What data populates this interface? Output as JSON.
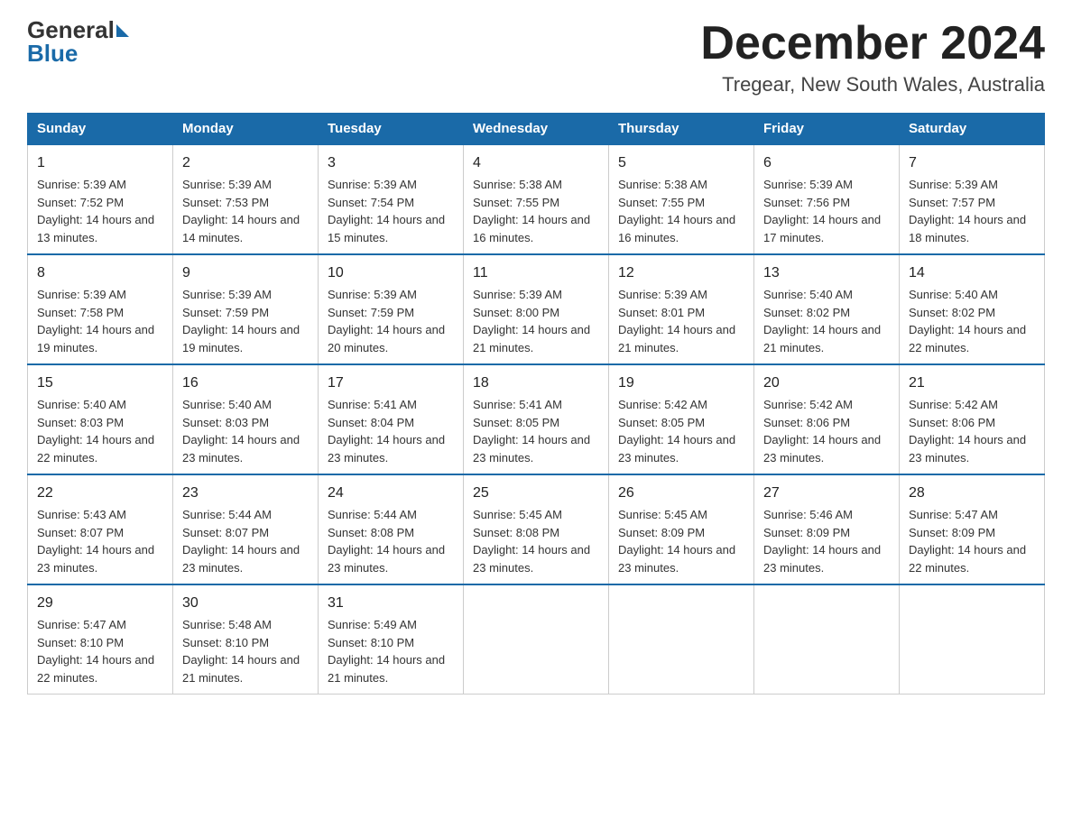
{
  "header": {
    "logo_general": "General",
    "logo_blue": "Blue",
    "month_title": "December 2024",
    "location": "Tregear, New South Wales, Australia"
  },
  "weekdays": [
    "Sunday",
    "Monday",
    "Tuesday",
    "Wednesday",
    "Thursday",
    "Friday",
    "Saturday"
  ],
  "weeks": [
    [
      {
        "day": "1",
        "sunrise": "5:39 AM",
        "sunset": "7:52 PM",
        "daylight": "14 hours and 13 minutes."
      },
      {
        "day": "2",
        "sunrise": "5:39 AM",
        "sunset": "7:53 PM",
        "daylight": "14 hours and 14 minutes."
      },
      {
        "day": "3",
        "sunrise": "5:39 AM",
        "sunset": "7:54 PM",
        "daylight": "14 hours and 15 minutes."
      },
      {
        "day": "4",
        "sunrise": "5:38 AM",
        "sunset": "7:55 PM",
        "daylight": "14 hours and 16 minutes."
      },
      {
        "day": "5",
        "sunrise": "5:38 AM",
        "sunset": "7:55 PM",
        "daylight": "14 hours and 16 minutes."
      },
      {
        "day": "6",
        "sunrise": "5:39 AM",
        "sunset": "7:56 PM",
        "daylight": "14 hours and 17 minutes."
      },
      {
        "day": "7",
        "sunrise": "5:39 AM",
        "sunset": "7:57 PM",
        "daylight": "14 hours and 18 minutes."
      }
    ],
    [
      {
        "day": "8",
        "sunrise": "5:39 AM",
        "sunset": "7:58 PM",
        "daylight": "14 hours and 19 minutes."
      },
      {
        "day": "9",
        "sunrise": "5:39 AM",
        "sunset": "7:59 PM",
        "daylight": "14 hours and 19 minutes."
      },
      {
        "day": "10",
        "sunrise": "5:39 AM",
        "sunset": "7:59 PM",
        "daylight": "14 hours and 20 minutes."
      },
      {
        "day": "11",
        "sunrise": "5:39 AM",
        "sunset": "8:00 PM",
        "daylight": "14 hours and 21 minutes."
      },
      {
        "day": "12",
        "sunrise": "5:39 AM",
        "sunset": "8:01 PM",
        "daylight": "14 hours and 21 minutes."
      },
      {
        "day": "13",
        "sunrise": "5:40 AM",
        "sunset": "8:02 PM",
        "daylight": "14 hours and 21 minutes."
      },
      {
        "day": "14",
        "sunrise": "5:40 AM",
        "sunset": "8:02 PM",
        "daylight": "14 hours and 22 minutes."
      }
    ],
    [
      {
        "day": "15",
        "sunrise": "5:40 AM",
        "sunset": "8:03 PM",
        "daylight": "14 hours and 22 minutes."
      },
      {
        "day": "16",
        "sunrise": "5:40 AM",
        "sunset": "8:03 PM",
        "daylight": "14 hours and 23 minutes."
      },
      {
        "day": "17",
        "sunrise": "5:41 AM",
        "sunset": "8:04 PM",
        "daylight": "14 hours and 23 minutes."
      },
      {
        "day": "18",
        "sunrise": "5:41 AM",
        "sunset": "8:05 PM",
        "daylight": "14 hours and 23 minutes."
      },
      {
        "day": "19",
        "sunrise": "5:42 AM",
        "sunset": "8:05 PM",
        "daylight": "14 hours and 23 minutes."
      },
      {
        "day": "20",
        "sunrise": "5:42 AM",
        "sunset": "8:06 PM",
        "daylight": "14 hours and 23 minutes."
      },
      {
        "day": "21",
        "sunrise": "5:42 AM",
        "sunset": "8:06 PM",
        "daylight": "14 hours and 23 minutes."
      }
    ],
    [
      {
        "day": "22",
        "sunrise": "5:43 AM",
        "sunset": "8:07 PM",
        "daylight": "14 hours and 23 minutes."
      },
      {
        "day": "23",
        "sunrise": "5:44 AM",
        "sunset": "8:07 PM",
        "daylight": "14 hours and 23 minutes."
      },
      {
        "day": "24",
        "sunrise": "5:44 AM",
        "sunset": "8:08 PM",
        "daylight": "14 hours and 23 minutes."
      },
      {
        "day": "25",
        "sunrise": "5:45 AM",
        "sunset": "8:08 PM",
        "daylight": "14 hours and 23 minutes."
      },
      {
        "day": "26",
        "sunrise": "5:45 AM",
        "sunset": "8:09 PM",
        "daylight": "14 hours and 23 minutes."
      },
      {
        "day": "27",
        "sunrise": "5:46 AM",
        "sunset": "8:09 PM",
        "daylight": "14 hours and 23 minutes."
      },
      {
        "day": "28",
        "sunrise": "5:47 AM",
        "sunset": "8:09 PM",
        "daylight": "14 hours and 22 minutes."
      }
    ],
    [
      {
        "day": "29",
        "sunrise": "5:47 AM",
        "sunset": "8:10 PM",
        "daylight": "14 hours and 22 minutes."
      },
      {
        "day": "30",
        "sunrise": "5:48 AM",
        "sunset": "8:10 PM",
        "daylight": "14 hours and 21 minutes."
      },
      {
        "day": "31",
        "sunrise": "5:49 AM",
        "sunset": "8:10 PM",
        "daylight": "14 hours and 21 minutes."
      },
      null,
      null,
      null,
      null
    ]
  ]
}
